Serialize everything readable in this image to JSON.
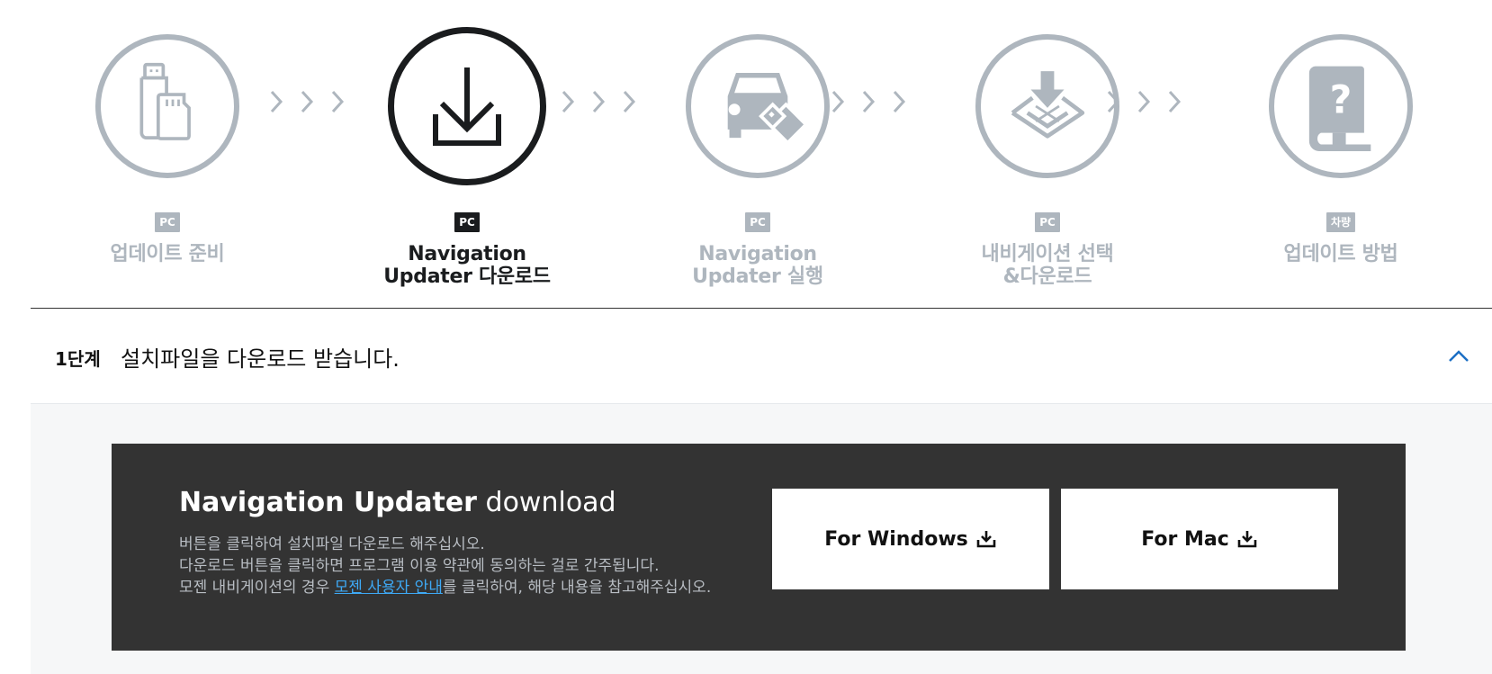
{
  "steps": [
    {
      "badge": "PC",
      "label": "업데이트 준비",
      "icon": "usb-sdcard-icon",
      "active": false
    },
    {
      "badge": "PC",
      "label": "Navigation\nUpdater 다운로드",
      "icon": "download-icon",
      "active": true
    },
    {
      "badge": "PC",
      "label": "Navigation\nUpdater 실행",
      "icon": "car-usb-icon",
      "active": false
    },
    {
      "badge": "PC",
      "label": "내비게이션 선택\n&다운로드",
      "icon": "map-download-icon",
      "active": false
    },
    {
      "badge": "차량",
      "label": "업데이트 방법",
      "icon": "manual-book-icon",
      "active": false
    }
  ],
  "stage": {
    "number": "1단계",
    "title": "설치파일을 다운로드 받습니다."
  },
  "download": {
    "title_bold": "Navigation Updater",
    "title_light": "download",
    "line1": "버튼을 클릭하여 설치파일 다운로드 해주십시오.",
    "line2": "다운로드 버튼을 클릭하면 프로그램 이용 약관에 동의하는 걸로 간주됩니다.",
    "line3_pre": "모젠 내비게이션의 경우 ",
    "line3_link": "모젠 사용자 안내",
    "line3_post": "를 클릭하여, 해당 내용을 참고해주십시오.",
    "windows_label": "For Windows",
    "mac_label": "For Mac"
  },
  "colors": {
    "inactive": "#aeb6be",
    "active": "#1a1c1e",
    "panel": "#333333",
    "link": "#3ea9f5"
  }
}
